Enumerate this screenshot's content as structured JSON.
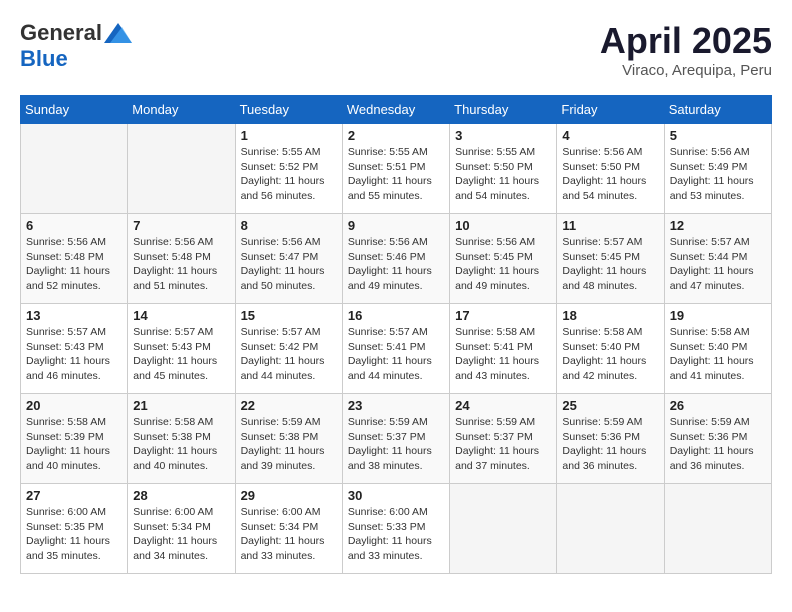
{
  "header": {
    "logo_general": "General",
    "logo_blue": "Blue",
    "title": "April 2025",
    "location": "Viraco, Arequipa, Peru"
  },
  "weekdays": [
    "Sunday",
    "Monday",
    "Tuesday",
    "Wednesday",
    "Thursday",
    "Friday",
    "Saturday"
  ],
  "weeks": [
    [
      {
        "day": "",
        "sunrise": "",
        "sunset": "",
        "daylight": ""
      },
      {
        "day": "",
        "sunrise": "",
        "sunset": "",
        "daylight": ""
      },
      {
        "day": "1",
        "sunrise": "Sunrise: 5:55 AM",
        "sunset": "Sunset: 5:52 PM",
        "daylight": "Daylight: 11 hours and 56 minutes."
      },
      {
        "day": "2",
        "sunrise": "Sunrise: 5:55 AM",
        "sunset": "Sunset: 5:51 PM",
        "daylight": "Daylight: 11 hours and 55 minutes."
      },
      {
        "day": "3",
        "sunrise": "Sunrise: 5:55 AM",
        "sunset": "Sunset: 5:50 PM",
        "daylight": "Daylight: 11 hours and 54 minutes."
      },
      {
        "day": "4",
        "sunrise": "Sunrise: 5:56 AM",
        "sunset": "Sunset: 5:50 PM",
        "daylight": "Daylight: 11 hours and 54 minutes."
      },
      {
        "day": "5",
        "sunrise": "Sunrise: 5:56 AM",
        "sunset": "Sunset: 5:49 PM",
        "daylight": "Daylight: 11 hours and 53 minutes."
      }
    ],
    [
      {
        "day": "6",
        "sunrise": "Sunrise: 5:56 AM",
        "sunset": "Sunset: 5:48 PM",
        "daylight": "Daylight: 11 hours and 52 minutes."
      },
      {
        "day": "7",
        "sunrise": "Sunrise: 5:56 AM",
        "sunset": "Sunset: 5:48 PM",
        "daylight": "Daylight: 11 hours and 51 minutes."
      },
      {
        "day": "8",
        "sunrise": "Sunrise: 5:56 AM",
        "sunset": "Sunset: 5:47 PM",
        "daylight": "Daylight: 11 hours and 50 minutes."
      },
      {
        "day": "9",
        "sunrise": "Sunrise: 5:56 AM",
        "sunset": "Sunset: 5:46 PM",
        "daylight": "Daylight: 11 hours and 49 minutes."
      },
      {
        "day": "10",
        "sunrise": "Sunrise: 5:56 AM",
        "sunset": "Sunset: 5:45 PM",
        "daylight": "Daylight: 11 hours and 49 minutes."
      },
      {
        "day": "11",
        "sunrise": "Sunrise: 5:57 AM",
        "sunset": "Sunset: 5:45 PM",
        "daylight": "Daylight: 11 hours and 48 minutes."
      },
      {
        "day": "12",
        "sunrise": "Sunrise: 5:57 AM",
        "sunset": "Sunset: 5:44 PM",
        "daylight": "Daylight: 11 hours and 47 minutes."
      }
    ],
    [
      {
        "day": "13",
        "sunrise": "Sunrise: 5:57 AM",
        "sunset": "Sunset: 5:43 PM",
        "daylight": "Daylight: 11 hours and 46 minutes."
      },
      {
        "day": "14",
        "sunrise": "Sunrise: 5:57 AM",
        "sunset": "Sunset: 5:43 PM",
        "daylight": "Daylight: 11 hours and 45 minutes."
      },
      {
        "day": "15",
        "sunrise": "Sunrise: 5:57 AM",
        "sunset": "Sunset: 5:42 PM",
        "daylight": "Daylight: 11 hours and 44 minutes."
      },
      {
        "day": "16",
        "sunrise": "Sunrise: 5:57 AM",
        "sunset": "Sunset: 5:41 PM",
        "daylight": "Daylight: 11 hours and 44 minutes."
      },
      {
        "day": "17",
        "sunrise": "Sunrise: 5:58 AM",
        "sunset": "Sunset: 5:41 PM",
        "daylight": "Daylight: 11 hours and 43 minutes."
      },
      {
        "day": "18",
        "sunrise": "Sunrise: 5:58 AM",
        "sunset": "Sunset: 5:40 PM",
        "daylight": "Daylight: 11 hours and 42 minutes."
      },
      {
        "day": "19",
        "sunrise": "Sunrise: 5:58 AM",
        "sunset": "Sunset: 5:40 PM",
        "daylight": "Daylight: 11 hours and 41 minutes."
      }
    ],
    [
      {
        "day": "20",
        "sunrise": "Sunrise: 5:58 AM",
        "sunset": "Sunset: 5:39 PM",
        "daylight": "Daylight: 11 hours and 40 minutes."
      },
      {
        "day": "21",
        "sunrise": "Sunrise: 5:58 AM",
        "sunset": "Sunset: 5:38 PM",
        "daylight": "Daylight: 11 hours and 40 minutes."
      },
      {
        "day": "22",
        "sunrise": "Sunrise: 5:59 AM",
        "sunset": "Sunset: 5:38 PM",
        "daylight": "Daylight: 11 hours and 39 minutes."
      },
      {
        "day": "23",
        "sunrise": "Sunrise: 5:59 AM",
        "sunset": "Sunset: 5:37 PM",
        "daylight": "Daylight: 11 hours and 38 minutes."
      },
      {
        "day": "24",
        "sunrise": "Sunrise: 5:59 AM",
        "sunset": "Sunset: 5:37 PM",
        "daylight": "Daylight: 11 hours and 37 minutes."
      },
      {
        "day": "25",
        "sunrise": "Sunrise: 5:59 AM",
        "sunset": "Sunset: 5:36 PM",
        "daylight": "Daylight: 11 hours and 36 minutes."
      },
      {
        "day": "26",
        "sunrise": "Sunrise: 5:59 AM",
        "sunset": "Sunset: 5:36 PM",
        "daylight": "Daylight: 11 hours and 36 minutes."
      }
    ],
    [
      {
        "day": "27",
        "sunrise": "Sunrise: 6:00 AM",
        "sunset": "Sunset: 5:35 PM",
        "daylight": "Daylight: 11 hours and 35 minutes."
      },
      {
        "day": "28",
        "sunrise": "Sunrise: 6:00 AM",
        "sunset": "Sunset: 5:34 PM",
        "daylight": "Daylight: 11 hours and 34 minutes."
      },
      {
        "day": "29",
        "sunrise": "Sunrise: 6:00 AM",
        "sunset": "Sunset: 5:34 PM",
        "daylight": "Daylight: 11 hours and 33 minutes."
      },
      {
        "day": "30",
        "sunrise": "Sunrise: 6:00 AM",
        "sunset": "Sunset: 5:33 PM",
        "daylight": "Daylight: 11 hours and 33 minutes."
      },
      {
        "day": "",
        "sunrise": "",
        "sunset": "",
        "daylight": ""
      },
      {
        "day": "",
        "sunrise": "",
        "sunset": "",
        "daylight": ""
      },
      {
        "day": "",
        "sunrise": "",
        "sunset": "",
        "daylight": ""
      }
    ]
  ]
}
